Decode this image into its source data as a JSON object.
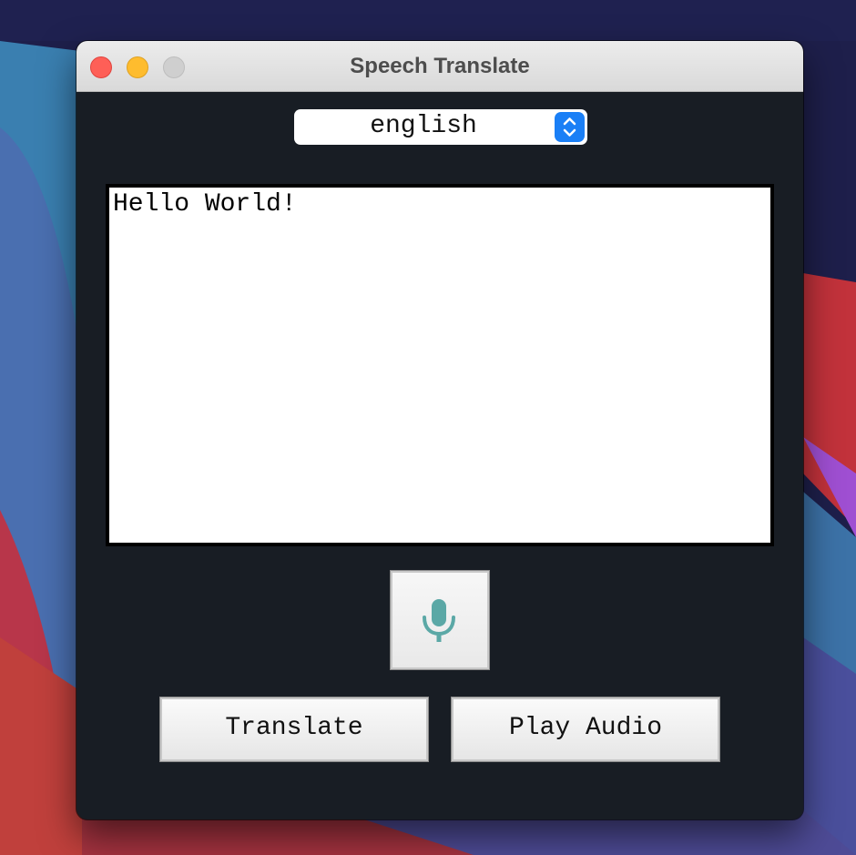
{
  "window": {
    "title": "Speech Translate"
  },
  "language_select": {
    "selected": "english"
  },
  "text_area": {
    "content": "Hello World!"
  },
  "buttons": {
    "translate_label": "Translate",
    "play_audio_label": "Play Audio"
  },
  "icons": {
    "microphone": "microphone-icon",
    "select_arrows": "chevron-up-down-icon"
  },
  "colors": {
    "accent": "#1a7ff6",
    "mic": "#5ba8a6",
    "window_bg": "#181d24"
  }
}
